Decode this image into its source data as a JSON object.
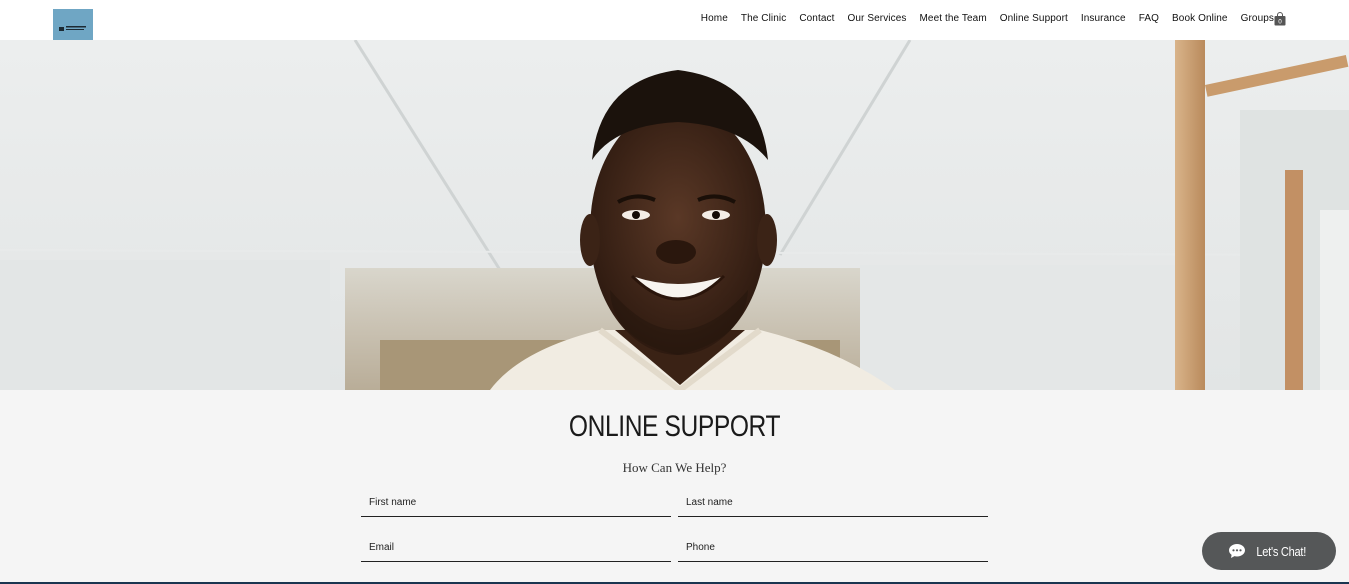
{
  "header": {
    "nav": [
      "Home",
      "The Clinic",
      "Contact",
      "Our Services",
      "Meet the Team",
      "Online Support",
      "Insurance",
      "FAQ",
      "Book Online",
      "Groups"
    ]
  },
  "hero": {
    "image_desc": "smiling man in white scrubs in a bright clinic hallway"
  },
  "section": {
    "title": "ONLINE SUPPORT",
    "subtitle": "How Can We Help?"
  },
  "form": {
    "first_name": "First name",
    "last_name": "Last name",
    "email": "Email",
    "phone": "Phone"
  },
  "chat": {
    "label": "Let's Chat!"
  },
  "colors": {
    "header_bg": "#ffffff",
    "logo_bg": "#6fa6c4",
    "section_bg": "#f5f5f5",
    "chat_bg": "#555758"
  }
}
